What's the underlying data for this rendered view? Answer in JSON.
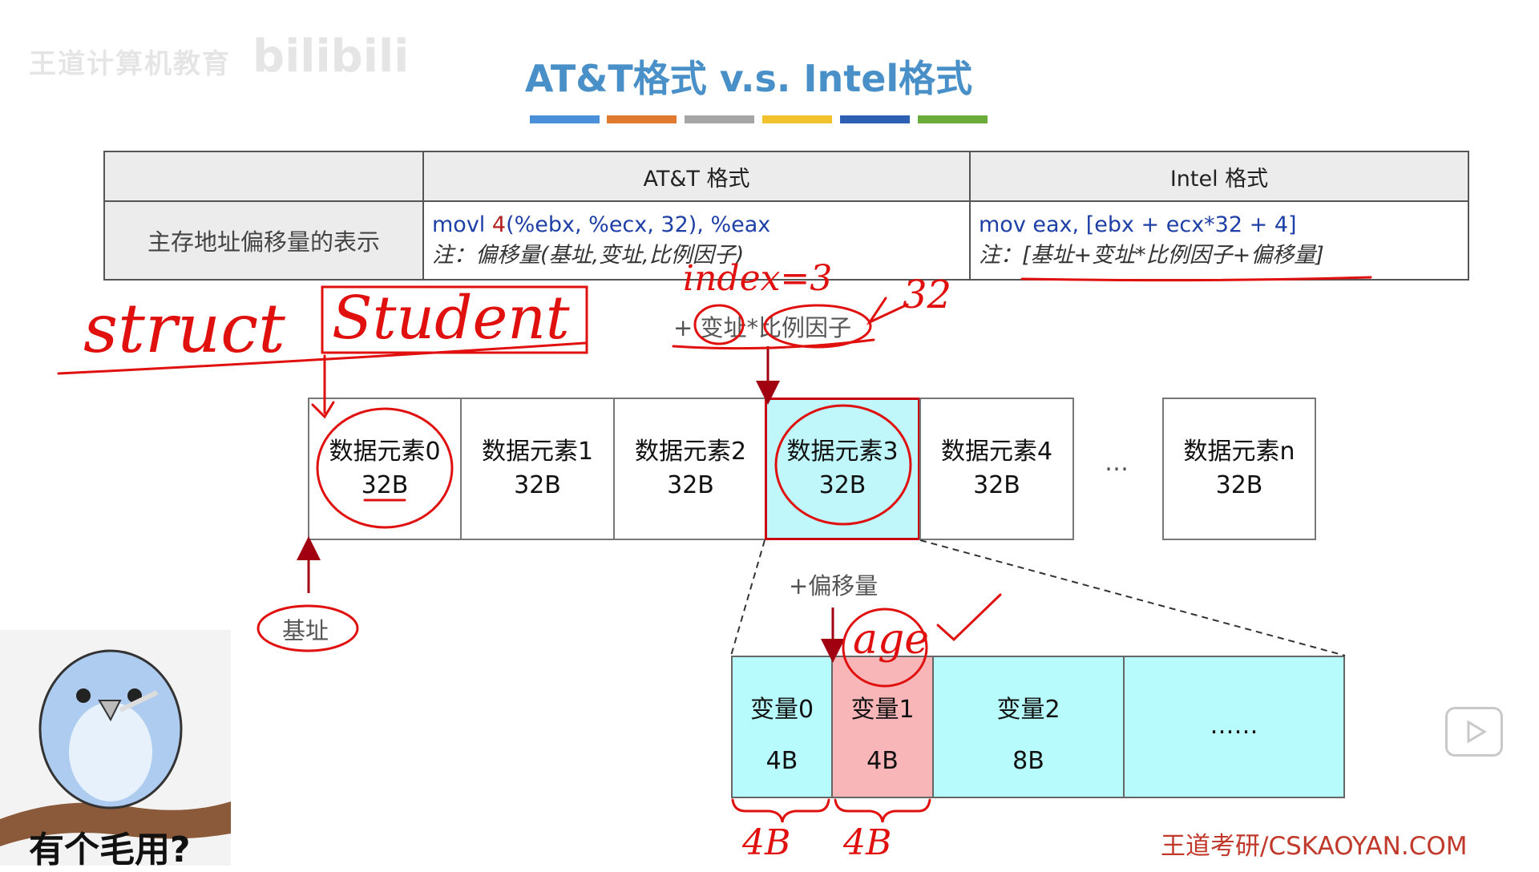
{
  "slide": {
    "title": "AT&T格式 v.s. Intel格式",
    "watermark_left": "王道计算机教育",
    "watermark_logo": "bilibili",
    "color_bar": [
      "#4a90d9",
      "#e07a2e",
      "#a6a6a6",
      "#f2c12e",
      "#2d5fb3",
      "#6aab3a"
    ],
    "brand": "王道考研/CSKAOYAN.COM"
  },
  "table": {
    "headers": [
      "",
      "AT&T 格式",
      "Intel 格式"
    ],
    "row_label": "主存地址偏移量的表示",
    "att": {
      "code_op": "movl ",
      "code_offset": "4",
      "code_rest": "(%ebx, %ecx, 32), %eax",
      "note": "注：偏移量(基址,变址,比例因子)"
    },
    "intel": {
      "code_op": "mov eax, ",
      "code_rest": "[ebx + ecx*32 + 4]",
      "note": "注：[基址+变址*比例因子+偏移量]"
    }
  },
  "diagram": {
    "index_label": "+ 变址*比例因子",
    "elements": [
      {
        "name": "数据元素0",
        "size": "32B"
      },
      {
        "name": "数据元素1",
        "size": "32B"
      },
      {
        "name": "数据元素2",
        "size": "32B"
      },
      {
        "name": "数据元素3",
        "size": "32B"
      },
      {
        "name": "数据元素4",
        "size": "32B"
      },
      {
        "name": "数据元素n",
        "size": "32B"
      }
    ],
    "ellipsis": "…",
    "base_label": "基址",
    "offset_label": "+偏移量",
    "fields": [
      {
        "name": "变量0",
        "size": "4B"
      },
      {
        "name": "变量1",
        "size": "4B"
      },
      {
        "name": "变量2",
        "size": "8B"
      }
    ],
    "fields_ellipsis": "……"
  },
  "handwriting": {
    "struct": "struct",
    "student": "Student",
    "index": "index=3",
    "scale": "32",
    "age": "age",
    "size_a": "4B",
    "size_b": "4B"
  },
  "meme": {
    "caption": "有个毛用?"
  }
}
